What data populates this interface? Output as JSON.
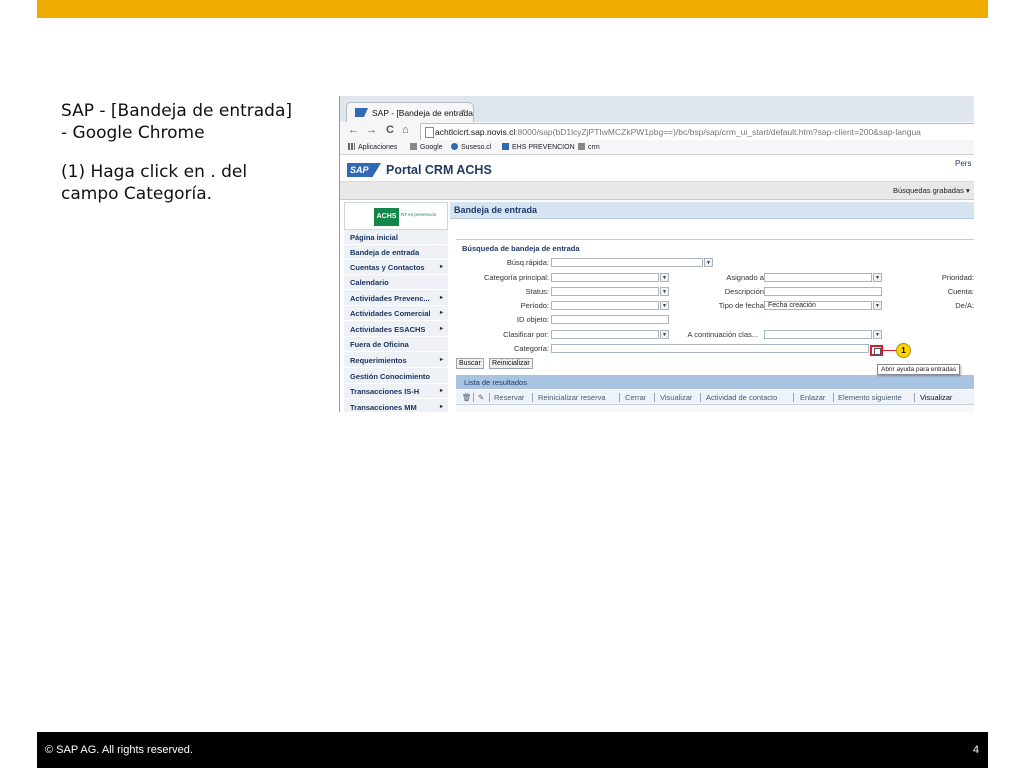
{
  "slide": {
    "title_line1": "SAP - [Bandeja de entrada]",
    "title_line2": "- Google Chrome",
    "instruction_line1": "(1) Haga click en . del",
    "instruction_line2": "campo Categoría.",
    "footer_copyright": "©  SAP AG. All rights reserved.",
    "page_number": "4",
    "accent_color": "#F0AB00"
  },
  "browser": {
    "tab_title": "SAP - [Bandeja de entrada",
    "tab_close": "×",
    "back_icon": "←",
    "forward_icon": "→",
    "reload_icon": "C",
    "home_icon": "⌂",
    "url_host": "achtlcicrt.sap.novis.cl",
    "url_rest": ":8000/sap(bD1lcyZjPTIwMCZkPW1pbg==)/bc/bsp/sap/crm_ui_start/default.htm?sap-client=200&sap-langua",
    "bookmarks": [
      "Aplicaciones",
      "Google",
      "Suseso.cl",
      "EHS PREVENCION",
      "crm"
    ]
  },
  "portal": {
    "sap_logo": "SAP",
    "title": "Portal CRM ACHS",
    "pers": "Pers",
    "saved_searches": "Búsquedas grabadas ▾",
    "org_logo": "ACHS",
    "org_logo_sub": "NT en prevención"
  },
  "nav": {
    "items": [
      {
        "label": "Página inicial",
        "arrow": ""
      },
      {
        "label": "Bandeja de entrada",
        "arrow": ""
      },
      {
        "label": "Cuentas y Contactos",
        "arrow": "▸"
      },
      {
        "label": "Calendario",
        "arrow": ""
      },
      {
        "label": "Actividades Prevenc...",
        "arrow": "▸"
      },
      {
        "label": "Actividades Comercial",
        "arrow": "▸"
      },
      {
        "label": "Actividades ESACHS",
        "arrow": "▸"
      },
      {
        "label": "Fuera de Oficina",
        "arrow": ""
      },
      {
        "label": "Requerimientos",
        "arrow": "▸"
      },
      {
        "label": "Gestión Conocimiento",
        "arrow": ""
      },
      {
        "label": "Transacciones IS-H",
        "arrow": "▸"
      },
      {
        "label": "Transacciones MM",
        "arrow": "▸"
      }
    ]
  },
  "content": {
    "title": "Bandeja de entrada",
    "search_panel_title": "Búsqueda de bandeja de entrada",
    "fields": {
      "busq_rapida": "Búsq.rápida:",
      "categoria_principal": "Categoría principal:",
      "status": "Status:",
      "periodo": "Período:",
      "id_objeto": "ID objeto:",
      "clasificar_por": "Clasificar por:",
      "categoria": "Categoría:",
      "asignado_a": "Asignado a:",
      "descripcion": "Descripción:",
      "tipo_de_fecha": "Tipo de fecha:",
      "tipo_de_fecha_value": "Fecha creación",
      "a_continuacion": "A continuación clas...",
      "prioridad": "Prioridad:",
      "cuenta": "Cuenta:",
      "de_a": "De/A:"
    },
    "buttons": {
      "buscar": "Buscar",
      "reinicializar": "Reinicializar"
    },
    "step_marker": "1",
    "tooltip": "Abrir ayuda para entradas",
    "results_title": "Lista de resultados",
    "result_tools": [
      "Reservar",
      "Reinicializar reserva",
      "Cerrar",
      "Visualizar",
      "Actividad de contacto",
      "Enlazar",
      "Elemento siguiente",
      "Visualizar"
    ]
  }
}
